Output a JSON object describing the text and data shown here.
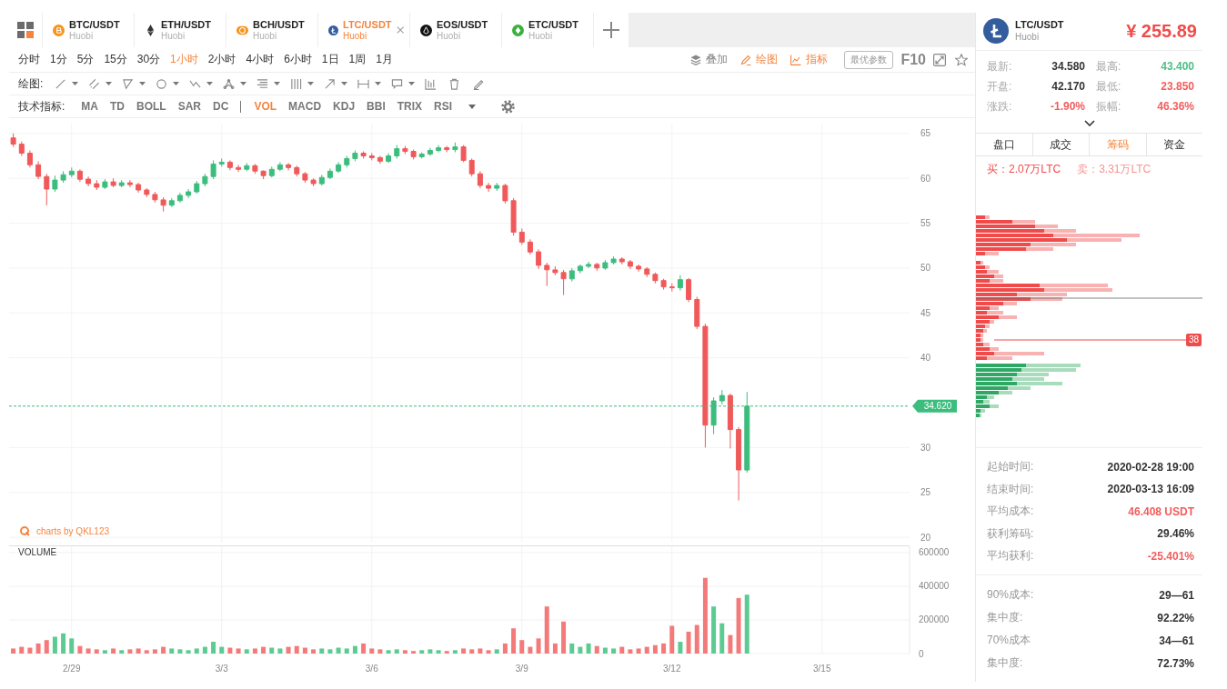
{
  "pair_tabs": [
    {
      "kind": "btc",
      "symbol": "BTC/USDT",
      "exchange": "Huobi",
      "selected": false
    },
    {
      "kind": "eth",
      "symbol": "ETH/USDT",
      "exchange": "Huobi",
      "selected": false
    },
    {
      "kind": "bch",
      "symbol": "BCH/USDT",
      "exchange": "Huobi",
      "selected": false
    },
    {
      "kind": "ltc",
      "symbol": "LTC/USDT",
      "exchange": "Huobi",
      "selected": true
    },
    {
      "kind": "eos",
      "symbol": "EOS/USDT",
      "exchange": "Huobi",
      "selected": false
    },
    {
      "kind": "etc",
      "symbol": "ETC/USDT",
      "exchange": "Huobi",
      "selected": false
    }
  ],
  "periods": [
    {
      "label": "分时",
      "selected": false
    },
    {
      "label": "1分",
      "selected": false
    },
    {
      "label": "5分",
      "selected": false
    },
    {
      "label": "15分",
      "selected": false
    },
    {
      "label": "30分",
      "selected": false
    },
    {
      "label": "1小时",
      "selected": true
    },
    {
      "label": "2小时",
      "selected": false
    },
    {
      "label": "4小时",
      "selected": false
    },
    {
      "label": "6小时",
      "selected": false
    },
    {
      "label": "1日",
      "selected": false
    },
    {
      "label": "1周",
      "selected": false
    },
    {
      "label": "1月",
      "selected": false
    }
  ],
  "chart_tools": [
    {
      "kind": "overlay",
      "label": "叠加",
      "selected": false
    },
    {
      "kind": "draw",
      "label": "绘图",
      "selected": true
    },
    {
      "kind": "indicator",
      "label": "指标",
      "selected": true
    }
  ],
  "params_button": {
    "label": "最优参数"
  },
  "f10_button": {
    "label": "F10"
  },
  "drawing_toolbar": {
    "label": "绘图:"
  },
  "indicator_bar": {
    "label": "技术指标:",
    "main": [
      {
        "label": "MA",
        "selected": false
      },
      {
        "label": "TD",
        "selected": false
      },
      {
        "label": "BOLL",
        "selected": false
      },
      {
        "label": "SAR",
        "selected": false
      },
      {
        "label": "DC",
        "selected": false
      }
    ],
    "sub": [
      {
        "label": "VOL",
        "selected": true
      },
      {
        "label": "MACD",
        "selected": false
      },
      {
        "label": "KDJ",
        "selected": false
      },
      {
        "label": "BBI",
        "selected": false
      },
      {
        "label": "TRIX",
        "selected": false
      },
      {
        "label": "RSI",
        "selected": false
      }
    ]
  },
  "price_chart": {
    "axis_labels": [
      "65",
      "60",
      "55",
      "50",
      "45",
      "40",
      "30",
      "25",
      "20"
    ],
    "current_price": "34.620",
    "credit": "charts by QKL123"
  },
  "volume_chart": {
    "chart_data": {
      "type": "bar",
      "title": "VOLUME",
      "categories": [
        null,
        null,
        null,
        null,
        null,
        null,
        null,
        "2/29",
        null,
        null,
        null,
        null,
        null,
        null,
        null,
        null,
        null,
        null,
        null,
        null,
        null,
        null,
        null,
        null,
        null,
        "3/3",
        null,
        null,
        null,
        null,
        null,
        null,
        null,
        null,
        null,
        null,
        null,
        null,
        null,
        null,
        null,
        null,
        null,
        "3/6",
        null,
        null,
        null,
        null,
        null,
        null,
        null,
        null,
        null,
        null,
        null,
        null,
        null,
        null,
        null,
        null,
        null,
        "3/9",
        null,
        null,
        null,
        null,
        null,
        null,
        null,
        null,
        null,
        null,
        null,
        null,
        null,
        null,
        null,
        null,
        null,
        "3/12",
        null,
        null,
        null,
        null,
        null,
        null,
        null,
        null,
        null,
        null,
        null,
        null,
        null,
        null,
        null,
        null,
        null,
        "3/15",
        null,
        null,
        null,
        null,
        null,
        null,
        null,
        null,
        null,
        null
      ],
      "series": [
        {
          "color": "#f47a7a",
          "values": [
            30000,
            40000,
            35000,
            60000,
            80000,
            0,
            0,
            0,
            45000,
            30000,
            25000,
            0,
            30000,
            0,
            25000,
            30000,
            20000,
            25000,
            40000,
            0,
            0,
            0,
            0,
            0,
            0,
            0,
            35000,
            30000,
            0,
            30000,
            40000,
            0,
            0,
            40000,
            45000,
            35000,
            25000,
            0,
            0,
            0,
            0,
            0,
            60000,
            30000,
            25000,
            0,
            0,
            20000,
            15000,
            0,
            0,
            0,
            15000,
            0,
            30000,
            25000,
            30000,
            20000,
            0,
            60000,
            150000,
            80000,
            40000,
            90000,
            280000,
            60000,
            190000,
            0,
            0,
            0,
            45000,
            0,
            0,
            40000,
            25000,
            30000,
            40000,
            50000,
            60000,
            165000,
            0,
            130000,
            170000,
            450000,
            0,
            0,
            110000,
            330000,
            0,
            0,
            0,
            0,
            0,
            0,
            0,
            0,
            0,
            0,
            0,
            0,
            0,
            0,
            0,
            0,
            0,
            0,
            0,
            0
          ]
        },
        {
          "color": "#5ccb92",
          "values": [
            0,
            0,
            0,
            0,
            0,
            100000,
            120000,
            90000,
            0,
            0,
            0,
            20000,
            0,
            20000,
            0,
            0,
            0,
            0,
            0,
            30000,
            25000,
            20000,
            30000,
            40000,
            70000,
            40000,
            0,
            0,
            25000,
            0,
            0,
            35000,
            30000,
            0,
            0,
            0,
            0,
            30000,
            25000,
            35000,
            30000,
            45000,
            0,
            0,
            0,
            20000,
            25000,
            0,
            0,
            20000,
            25000,
            20000,
            0,
            20000,
            0,
            0,
            0,
            0,
            25000,
            0,
            0,
            0,
            0,
            0,
            0,
            0,
            0,
            60000,
            40000,
            60000,
            0,
            35000,
            30000,
            0,
            0,
            0,
            0,
            0,
            0,
            0,
            70000,
            0,
            0,
            0,
            280000,
            180000,
            0,
            0,
            350000,
            0,
            0,
            0,
            0,
            0,
            0,
            0,
            0,
            0,
            0,
            0,
            0,
            0,
            0,
            0,
            0,
            0,
            0,
            0
          ]
        }
      ],
      "stacked": true,
      "grid": true,
      "ylim": [
        0,
        643000
      ],
      "yticks": [
        0,
        200000,
        400000,
        600000
      ]
    }
  },
  "ticker": {
    "symbol": "LTC/USDT",
    "exchange": "Huobi",
    "price": "¥ 255.89",
    "stats": [
      {
        "label": "最新:",
        "value": "34.580",
        "color": "#333333"
      },
      {
        "label": "最高:",
        "value": "43.400",
        "color": "#4cbf85"
      },
      {
        "label": "开盘:",
        "value": "42.170",
        "color": "#333333"
      },
      {
        "label": "最低:",
        "value": "23.850",
        "color": "#f25c5c"
      },
      {
        "label": "涨跌:",
        "value": "-1.90%",
        "color": "#f25c5c"
      },
      {
        "label": "振幅:",
        "value": "46.36%",
        "color": "#f25c5c"
      }
    ]
  },
  "panel_tabs": [
    {
      "label": "盘口",
      "selected": false
    },
    {
      "label": "成交",
      "selected": false
    },
    {
      "label": "筹码",
      "selected": true
    },
    {
      "label": "资金",
      "selected": false
    }
  ],
  "chip_summary": [
    {
      "text": "买：2.07万LTC",
      "color": "#f04b4b"
    },
    {
      "text": "卖：3.31万LTC",
      "color": "#f59393"
    }
  ],
  "chip_chart": {
    "marker": "38"
  },
  "cost_info": [
    {
      "label": "起始时间:",
      "value": "2020-02-28 19:00",
      "color": "#333333"
    },
    {
      "label": "结束时间:",
      "value": "2020-03-13 16:09",
      "color": "#333333"
    },
    {
      "label": "平均成本:",
      "value": "46.408 USDT",
      "color": "#f25c5c"
    },
    {
      "label": "获利筹码:",
      "value": "29.46%",
      "color": "#333333"
    },
    {
      "label": "平均获利:",
      "value": "-25.401%",
      "color": "#f25c5c"
    }
  ],
  "concentration": [
    {
      "label": "90%成本:",
      "value": "29—61",
      "color": "#333333"
    },
    {
      "label": "集中度:",
      "value": "92.22%",
      "color": "#333333"
    },
    {
      "label": "70%成本",
      "value": "34—61",
      "color": "#333333"
    },
    {
      "label": "集中度:",
      "value": "72.73%",
      "color": "#333333"
    }
  ]
}
